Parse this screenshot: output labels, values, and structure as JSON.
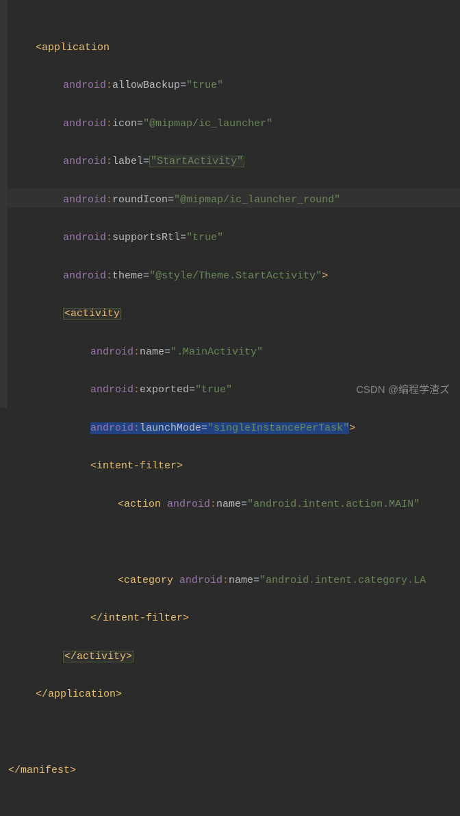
{
  "code": {
    "application_tag": "<application",
    "attrs": [
      {
        "ns": "android",
        "name": "allowBackup",
        "value": "\"true\""
      },
      {
        "ns": "android",
        "name": "icon",
        "value": "\"@mipmap/ic_launcher\""
      },
      {
        "ns": "android",
        "name": "label",
        "value": "\"StartActivity\"",
        "highlight_value": true
      },
      {
        "ns": "android",
        "name": "roundIcon",
        "value": "\"@mipmap/ic_launcher_round\""
      },
      {
        "ns": "android",
        "name": "supportsRtl",
        "value": "\"true\""
      },
      {
        "ns": "android",
        "name": "theme",
        "value": "\"@style/Theme.StartActivity\"",
        "closing": ">"
      }
    ],
    "activity_tag": "<activity",
    "activity_attrs": [
      {
        "ns": "android",
        "name": "name",
        "value": "\".MainActivity\""
      },
      {
        "ns": "android",
        "name": "exported",
        "value": "\"true\""
      },
      {
        "ns": "android",
        "name": "launchMode",
        "value": "\"singleInstancePerTask\"",
        "selected": true,
        "closing": ">"
      }
    ],
    "intent_filter_open": "<intent-filter>",
    "action_line": {
      "tag": "<action ",
      "ns": "android",
      "attr": "name",
      "value": "\"android.intent.action.MAIN\""
    },
    "category_line": {
      "tag": "<category ",
      "ns": "android",
      "attr": "name",
      "value": "\"android.intent.category.LA"
    },
    "intent_filter_close": "</intent-filter>",
    "activity_close": "</activity>",
    "application_close": "</application>",
    "manifest_close": "</manifest>"
  },
  "watermark": "CSDN @编程学渣ズ"
}
